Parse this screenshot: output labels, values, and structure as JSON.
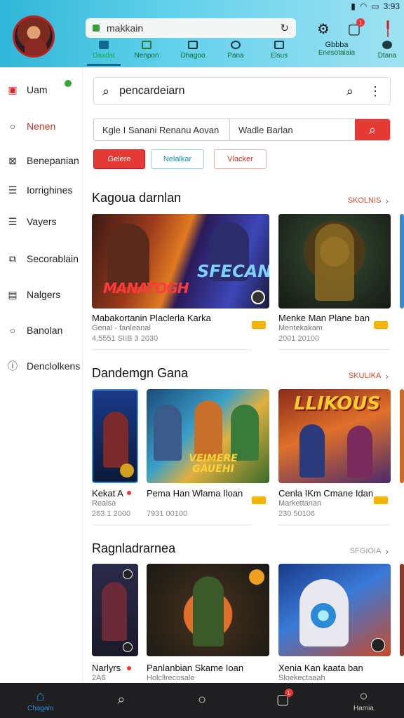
{
  "status": {
    "time": "3:93",
    "icons": [
      "signal-icon",
      "wifi-icon",
      "battery-icon"
    ]
  },
  "header": {
    "url_value": "makkain",
    "tabs": [
      {
        "label": "Daxdat",
        "icon": "grid-icon",
        "active": true
      },
      {
        "label": "Nenpon",
        "icon": "image-icon",
        "active": false
      },
      {
        "label": "Dhagoo",
        "icon": "monitor-icon",
        "active": false
      },
      {
        "label": "Pana",
        "icon": "star-icon",
        "active": false
      },
      {
        "label": "Elsus",
        "icon": "box-icon",
        "active": false
      },
      {
        "label": "Enesotaiaia",
        "title": "Gbbba",
        "icon": "chart-icon",
        "active": false
      },
      {
        "label": "Dtana",
        "icon": "user-icon",
        "active": false
      }
    ],
    "notification_count": "1"
  },
  "sidebar": {
    "items": [
      {
        "label": "Uam",
        "icon": "store-icon",
        "badge": "•"
      },
      {
        "label": "Nenen",
        "icon": "circle-icon"
      },
      {
        "label": "Benepanian",
        "icon": "image-icon"
      },
      {
        "label": "Iorrighines",
        "icon": "list-icon"
      },
      {
        "label": "Vayers",
        "icon": "list-icon"
      },
      {
        "label": "Secorablain",
        "icon": "puzzle-icon"
      },
      {
        "label": "Nalgers",
        "icon": "note-icon"
      },
      {
        "label": "Banolan",
        "icon": "circle-icon"
      },
      {
        "label": "Denclolkens",
        "icon": "info-icon"
      }
    ]
  },
  "search": {
    "value": "pencardeiarn"
  },
  "filters": {
    "field1": "Kgle I Sanani  Renanu Aovan",
    "field2": "Wadle Barlan"
  },
  "chips": [
    "Gelere",
    "Nelalkar",
    "Vlacker"
  ],
  "sections": [
    {
      "title": "Kagoua darnlan",
      "more": "SKOLNIS",
      "cards": [
        {
          "title": "Mabakortanin Placlerla Karka",
          "sub": "Genal - fanleanal",
          "meta": "4,5551 SIIB 3 2030",
          "art": "MANATOGH",
          "art2": "SFECAN"
        },
        {
          "title": "Menke Man Plane ban",
          "sub": "Mentekakam",
          "meta": "2001 20100"
        }
      ]
    },
    {
      "title": "Dandemgn Gana",
      "more": "SKULIKA",
      "cards": [
        {
          "title": "Kekat A",
          "sub": "Realsa",
          "meta": "263.1 2000"
        },
        {
          "title": "Pema Han Wlama Iloan",
          "sub": "",
          "meta": "7931 00100",
          "art": "VEIMERE GAUEHI"
        },
        {
          "title": "Cenla IKm Cmane Idan",
          "sub": "Markettanan",
          "meta": "230 50106",
          "art": "LLIKOUS"
        }
      ]
    },
    {
      "title": "Ragnladrarnea",
      "more": "SFGIOIA",
      "cards": [
        {
          "title": "Narlyrs",
          "sub": "2A6",
          "meta": ""
        },
        {
          "title": "Panlanbian Skame Ioan",
          "sub": "Holcllrecosale",
          "meta": ""
        },
        {
          "title": "Xenia Kan kaata ban",
          "sub": "Sloekectaaah",
          "meta": ""
        }
      ]
    }
  ],
  "bottom_nav": [
    {
      "label": "Chagain",
      "icon": "home-icon",
      "active": true
    },
    {
      "label": "",
      "icon": "search-icon",
      "active": false
    },
    {
      "label": "",
      "icon": "circle-icon",
      "active": false
    },
    {
      "label": "",
      "icon": "square-icon",
      "active": false,
      "badge": "1"
    },
    {
      "label": "Hamia",
      "icon": "user-icon",
      "active": false
    }
  ],
  "colors": {
    "accent": "#e53935",
    "header": "#3fbfe0",
    "nav_active": "#2b8fd6"
  }
}
